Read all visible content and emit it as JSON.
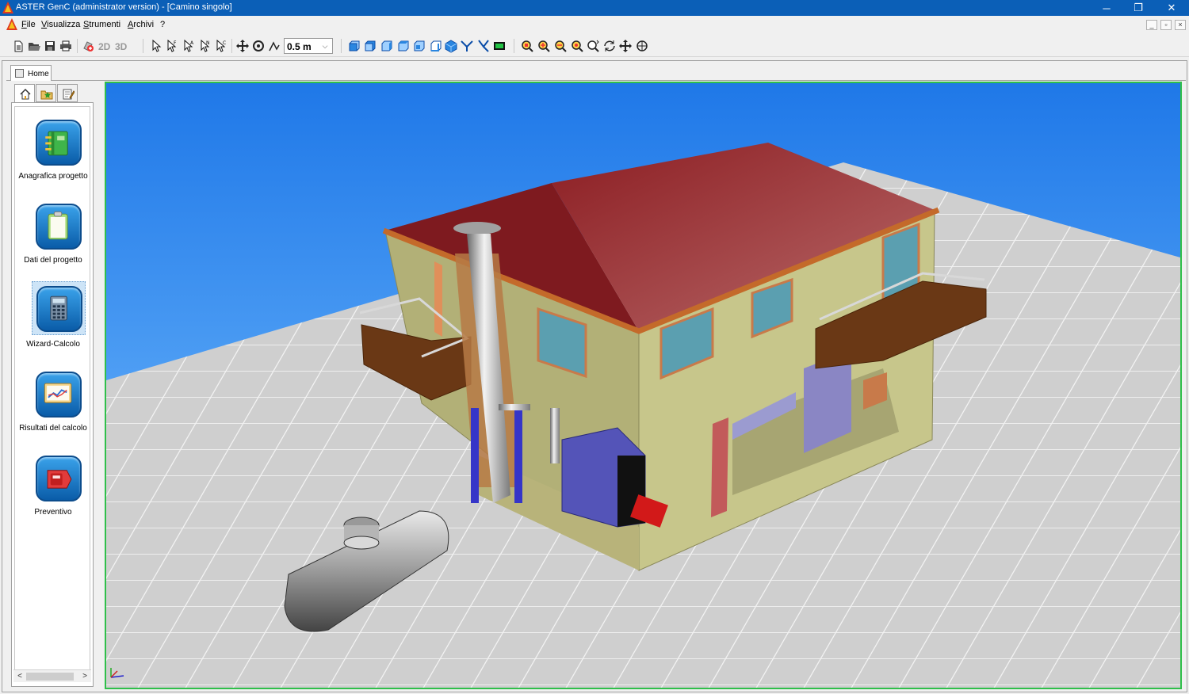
{
  "window": {
    "title": "ASTER GenC (administrator version) - [Camino singolo]",
    "minimize_label": "─",
    "restore_label": "❐",
    "close_label": "✕"
  },
  "menubar": {
    "items": [
      {
        "key": "F",
        "rest": "ile"
      },
      {
        "key": "V",
        "rest": "isualizza"
      },
      {
        "key": "S",
        "rest": "trumenti"
      },
      {
        "key": "A",
        "rest": "rchivi"
      },
      {
        "key": "",
        "rest": "?"
      }
    ],
    "mdi_minimize": "_",
    "mdi_restore": "▫",
    "mdi_close": "×"
  },
  "toolbar": {
    "mode_2d": "2D",
    "mode_3d": "3D",
    "step_value": "0.5  m",
    "combo_arrow": "⌵"
  },
  "document_tab": {
    "label": "Home"
  },
  "side_panel": {
    "buttons": [
      {
        "label": "Anagrafica progetto",
        "icon": "binder-icon"
      },
      {
        "label": "Dati del progetto",
        "icon": "clipboard-icon"
      },
      {
        "label": "Wizard-Calcolo",
        "icon": "calculator-icon"
      },
      {
        "label": "Risultati del calcolo",
        "icon": "chart-board-icon"
      },
      {
        "label": "Preventivo",
        "icon": "price-tag-icon"
      }
    ],
    "selected_index": 2,
    "scroll_left": "<",
    "scroll_right": ">"
  },
  "viewport": {
    "scene": "3d-house-with-chimney-boiler-and-tank",
    "sky_color": "#1f78e8",
    "floor_color": "#cfcfcf",
    "roof_color": "#8c1d22",
    "wall_color": "#bfbe84",
    "border_color": "#2fbf4a"
  }
}
